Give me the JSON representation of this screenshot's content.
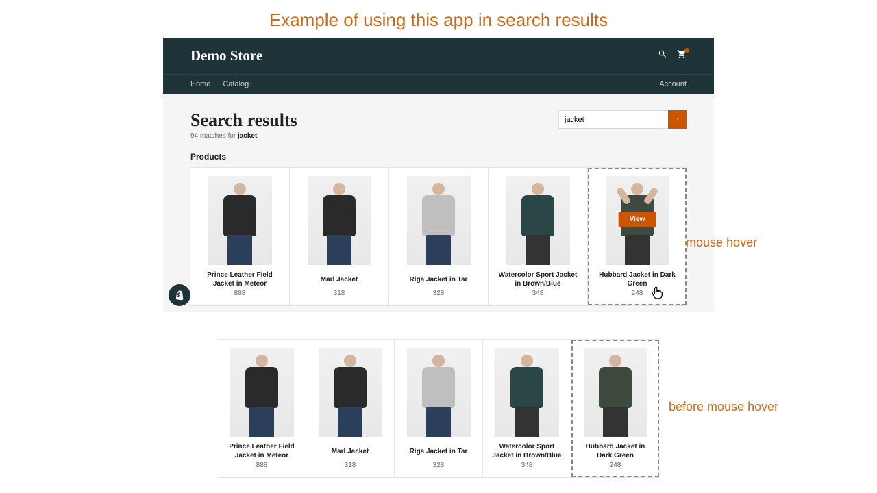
{
  "page_title": "Example of using this app in search results",
  "annotations": {
    "hover": "on mouse hover",
    "before": "before mouse hover"
  },
  "store": {
    "name": "Demo Store",
    "nav": {
      "home": "Home",
      "catalog": "Catalog",
      "account": "Account"
    }
  },
  "search": {
    "title": "Search results",
    "count": "94",
    "matches_for": "matches for",
    "query": "jacket",
    "section_label": "Products",
    "input_value": "jacket",
    "view_button": "View"
  },
  "products": [
    {
      "name": "Prince Leather Field Jacket in Meteor",
      "price": "888",
      "torso": "c-black",
      "legs": "l-blue"
    },
    {
      "name": "Marl Jacket",
      "price": "318",
      "torso": "c-black",
      "legs": "l-blue"
    },
    {
      "name": "Riga Jacket in Tar",
      "price": "328",
      "torso": "c-grey",
      "legs": "l-blue"
    },
    {
      "name": "Watercolor Sport Jacket in Brown/Blue",
      "price": "348",
      "torso": "c-darkteal",
      "legs": "l-dark"
    },
    {
      "name": "Hubbard Jacket in Dark Green",
      "price": "248",
      "torso": "c-darkgreen",
      "legs": "l-dark"
    }
  ]
}
